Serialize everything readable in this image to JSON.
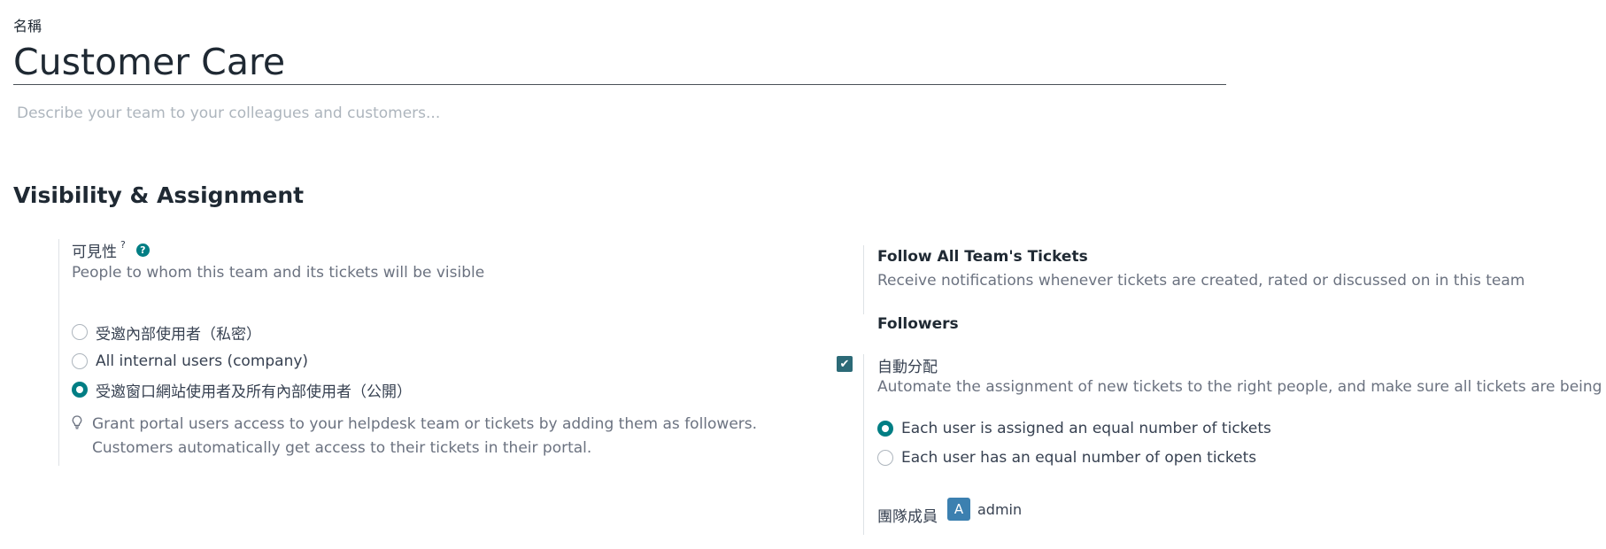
{
  "form": {
    "name_label": "名稱",
    "name_value": "Customer Care",
    "description_placeholder": "Describe your team to your colleagues and customers..."
  },
  "section": {
    "title": "Visibility & Assignment"
  },
  "visibility": {
    "label": "可見性",
    "label_sup": "?",
    "help_icon": "?",
    "description": "People to whom this team and its tickets will be visible",
    "options": [
      {
        "label": "受邀內部使用者（私密）",
        "selected": false
      },
      {
        "label": "All internal users (company)",
        "selected": false
      },
      {
        "label": "受邀窗口網站使用者及所有內部使用者（公開）",
        "selected": true
      }
    ],
    "hint_icon": "lightbulb-icon",
    "hint": "Grant portal users access to your helpdesk team or tickets by adding them as followers. Customers automatically get access to their tickets in their portal."
  },
  "follow": {
    "title": "Follow All Team's Tickets",
    "description": "Receive notifications whenever tickets are created, rated or discussed on in this team",
    "followers_title": "Followers"
  },
  "auto_assign": {
    "checked": true,
    "check_glyph": "✔",
    "label": "自動分配",
    "description": "Automate the assignment of new tickets to the right people, and make sure all tickets are being handled",
    "options": [
      {
        "label": "Each user is assigned an equal number of tickets",
        "selected": true
      },
      {
        "label": "Each user has an equal number of open tickets",
        "selected": false
      }
    ]
  },
  "members": {
    "label": "團隊成員",
    "items": [
      {
        "initial": "A",
        "name": "admin"
      }
    ]
  },
  "colors": {
    "accent": "#017e84",
    "checkbox": "#2c6a77",
    "avatar": "#3c80b0",
    "muted_text": "#6b7280"
  }
}
